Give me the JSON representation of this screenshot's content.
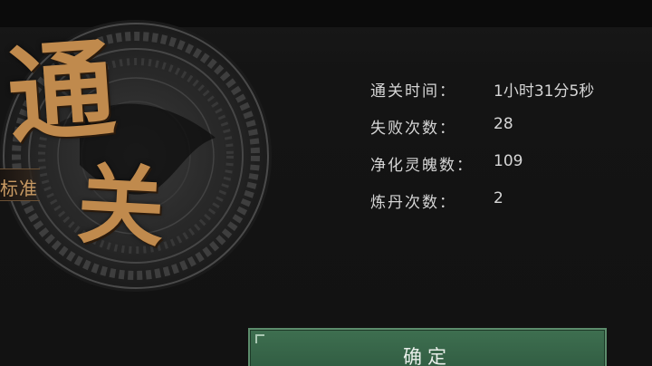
{
  "emblem": {
    "title_chars": [
      "通",
      "关"
    ],
    "difficulty": "标准",
    "accent_color": "#c08a4d"
  },
  "stats": [
    {
      "label": "通关时间：",
      "value": "1小时31分5秒"
    },
    {
      "label": "失败次数：",
      "value": "28"
    },
    {
      "label": "净化灵魄数：",
      "value": "109"
    },
    {
      "label": "炼丹次数：",
      "value": "2"
    }
  ],
  "confirm_button": {
    "label": "确定",
    "color": "#3e6f50"
  }
}
